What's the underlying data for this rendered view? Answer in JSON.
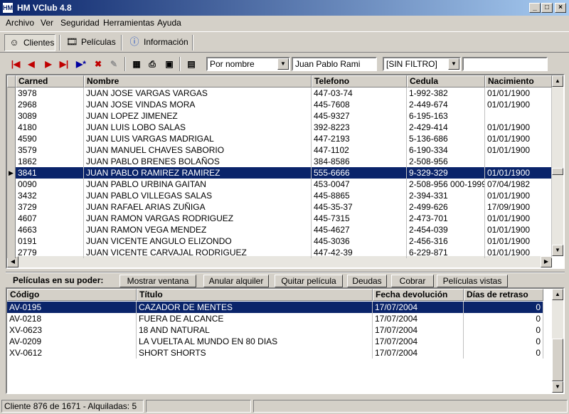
{
  "window": {
    "title": "HM VClub 4.8",
    "min": "_",
    "max": "□",
    "close": "×"
  },
  "menu": [
    "Archivo",
    "Ver",
    "Seguridad",
    "Herramientas",
    "Ayuda"
  ],
  "nav": {
    "clientes": "Clientes",
    "peliculas": "Películas",
    "informacion": "Información"
  },
  "toolbar": {
    "search_mode": "Por nombre",
    "search_value": "Juan Pablo Rami",
    "filter": "[SIN FILTRO]",
    "filter_value": ""
  },
  "clients": {
    "columns": [
      "Carned",
      "Nombre",
      "Telefono",
      "Cedula",
      "Nacimiento"
    ],
    "rows": [
      [
        "3978",
        "JUAN JOSE VARGAS VARGAS",
        "447-03-74",
        "1-992-382",
        "01/01/1900"
      ],
      [
        "2968",
        "JUAN JOSE VINDAS MORA",
        "445-7608",
        "2-449-674",
        "01/01/1900"
      ],
      [
        "3089",
        "JUAN LOPEZ JIMENEZ",
        "445-9327",
        "6-195-163",
        ""
      ],
      [
        "4180",
        "JUAN LUIS LOBO SALAS",
        "392-8223",
        "2-429-414",
        "01/01/1900"
      ],
      [
        "4590",
        "JUAN LUIS VARGAS MADRIGAL",
        "447-2193",
        "5-136-686",
        "01/01/1900"
      ],
      [
        "3579",
        "JUAN MANUEL CHAVES SABORIO",
        "447-1102",
        "6-190-334",
        "01/01/1900"
      ],
      [
        "1862",
        "JUAN PABLO BRENES BOLAÑOS",
        "384-8586",
        "2-508-956",
        ""
      ],
      [
        "3841",
        "JUAN PABLO RAMIREZ RAMIREZ",
        "555-6666",
        "9-329-329",
        "01/01/1900"
      ],
      [
        "0090",
        "JUAN PABLO URBINA GAITAN",
        "453-0047",
        "2-508-956 000-1999",
        "07/04/1982"
      ],
      [
        "3432",
        "JUAN PABLO VILLEGAS SALAS",
        "445-8865",
        "2-394-331",
        "01/01/1900"
      ],
      [
        "3729",
        "JUAN RAFAEL ARIAS ZUÑIGA",
        "445-35-37",
        "2-499-626",
        "17/09/1900"
      ],
      [
        "4607",
        "JUAN RAMON VARGAS RODRIGUEZ",
        "445-7315",
        "2-473-701",
        "01/01/1900"
      ],
      [
        "4663",
        "JUAN RAMON VEGA MENDEZ",
        "445-4627",
        "2-454-039",
        "01/01/1900"
      ],
      [
        "0191",
        "JUAN VICENTE ANGULO ELIZONDO",
        "445-3036",
        "2-456-316",
        "01/01/1900"
      ],
      [
        "2779",
        "JUAN VICENTE CARVAJAL RODRIGUEZ",
        "447-42-39",
        "6-229-871",
        "01/01/1900"
      ]
    ],
    "selected_index": 7
  },
  "panel": {
    "label": "Películas en su poder:",
    "buttons": [
      "Mostrar ventana",
      "Anular alquiler",
      "Quitar película",
      "Deudas",
      "Cobrar",
      "Películas vistas"
    ]
  },
  "movies": {
    "columns": [
      "Código",
      "Título",
      "Fecha devolución",
      "Días de retraso"
    ],
    "rows": [
      [
        "AV-0195",
        "CAZADOR DE MENTES",
        "17/07/2004",
        "0"
      ],
      [
        "AV-0218",
        "FUERA DE ALCANCE",
        "17/07/2004",
        "0"
      ],
      [
        "XV-0623",
        "18 AND NATURAL",
        "17/07/2004",
        "0"
      ],
      [
        "AV-0209",
        "LA VUELTA AL MUNDO EN 80 DIAS",
        "17/07/2004",
        "0"
      ],
      [
        "XV-0612",
        "SHORT SHORTS",
        "17/07/2004",
        "0"
      ]
    ],
    "selected_index": 0
  },
  "status": {
    "text": "Cliente 876 de 1671 - Alquiladas: 5"
  }
}
